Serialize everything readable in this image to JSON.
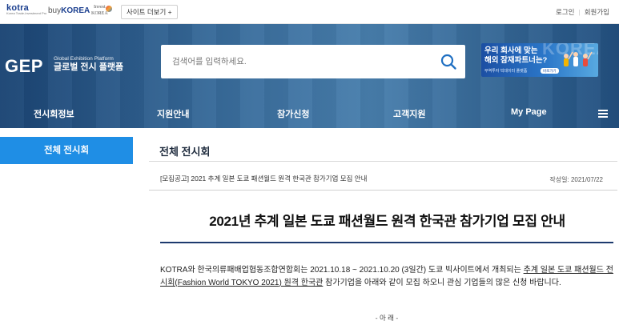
{
  "topbar": {
    "logos": {
      "kotra_word": "kotra",
      "kotra_sub": "Korea Trade-Investment Promotion Agency",
      "buykorea_prefix": "buy",
      "buykorea_main": "KOREA",
      "invest_top": "Invest",
      "invest_bottom": "KOREA"
    },
    "more_sites_label": "사이트 더보기 +",
    "links": {
      "login": "로그인",
      "signup": "회원가입"
    }
  },
  "header": {
    "brand": "GEP",
    "brand_en": "Global Exhibition Platform",
    "brand_ko": "글로벌 전시 플랫폼",
    "search": {
      "placeholder": "검색어를 입력하세요.",
      "value": ""
    },
    "banner": {
      "bg_word": "KOREA",
      "line1": "우리 회사에 맞는",
      "line2": "해외 잠재파트너는?",
      "line3": "무역투자 빅데이터 플랫폼",
      "cta": "바로가기"
    }
  },
  "gnb": {
    "items": [
      "전시회정보",
      "지원안내",
      "참가신청",
      "고객지원",
      "My Page"
    ]
  },
  "sidebar": {
    "active_label": "전체 전시회"
  },
  "content": {
    "section_title": "전체 전시회",
    "post_subject": "[모집공고] 2021 추계 일본 도쿄 패션월드 원격 한국관 참가기업 모집 안내",
    "post_date_label": "작성일:",
    "post_date": "2021/07/22",
    "headline": "2021년 추계 일본 도쿄 패션월드 원격 한국관 참가기업 모집 안내",
    "body": {
      "part1": "KOTRA와 한국의류패배업협동조합연합회는 2021.10.18 ~ 2021.10.20 (3일간) 도쿄 빅사이트에서 개최되는 ",
      "underlined": "추계 일본 도쿄 패션월드 전시회(Fashion World TOKYO 2021) 원격 한국관",
      "part2": " 참가기업을 아래와 같이 모집 하오니 관심 기업들의 많은 신청 바랍니다."
    },
    "section_marker": "- 아 래 -"
  },
  "colors": {
    "brand_navy": "#1d3a6e",
    "accent_blue": "#1f8ee5",
    "hero_blue": "#1c568c"
  }
}
